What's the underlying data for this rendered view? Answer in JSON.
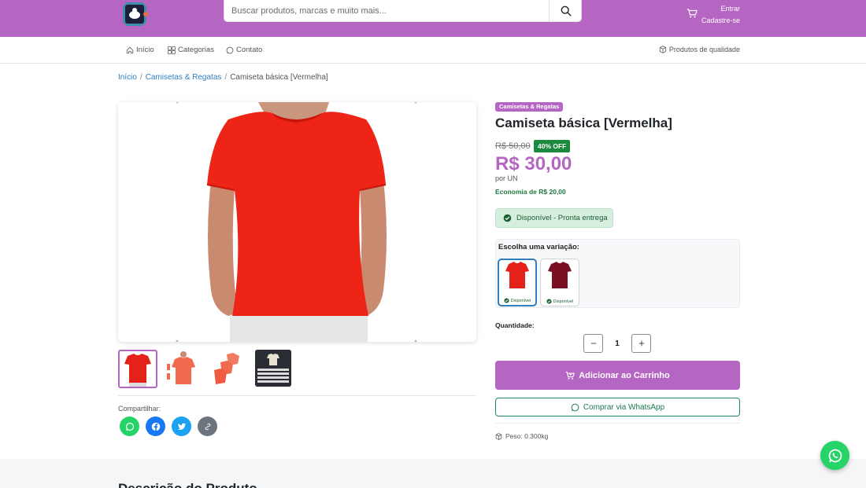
{
  "header": {
    "search_placeholder": "Buscar produtos, marcas e muito mais...",
    "login_label": "Entrar",
    "signup_label": "Cadastre-se",
    "brand_color": "#b565c2"
  },
  "nav": {
    "items": [
      {
        "label": "Início",
        "icon": "home-icon"
      },
      {
        "label": "Categorias",
        "icon": "grid-icon"
      },
      {
        "label": "Contato",
        "icon": "whatsapp-icon"
      }
    ],
    "quality_label": "Produtos de qualidade"
  },
  "breadcrumb": {
    "home": "Início",
    "category": "Camisetas & Regatas",
    "current": "Camiseta básica [Vermelha]"
  },
  "product": {
    "category_badge": "Camisetas & Regatas",
    "title": "Camiseta básica [Vermelha]",
    "old_price": "R$ 50,00",
    "discount": "40% OFF",
    "price": "R$ 30,00",
    "unit": "por UN",
    "savings": "Economia de R$ 20,00",
    "stock": "Disponível - Pronta entrega",
    "share_label": "Compartilhar:",
    "weight": "Peso: 0.300kg"
  },
  "variations": {
    "label": "Escolha uma variação:",
    "options": [
      {
        "color": "#e8241c",
        "status": "Disponível",
        "selected": true
      },
      {
        "color": "#7a1024",
        "status": "Disponível",
        "selected": false
      }
    ]
  },
  "quantity": {
    "label": "Quantidade:",
    "value": "1"
  },
  "actions": {
    "add_to_cart": "Adicionar ao Carrinho",
    "buy_whatsapp": "Comprar via WhatsApp"
  },
  "description": {
    "title": "Descrição do Produto"
  }
}
